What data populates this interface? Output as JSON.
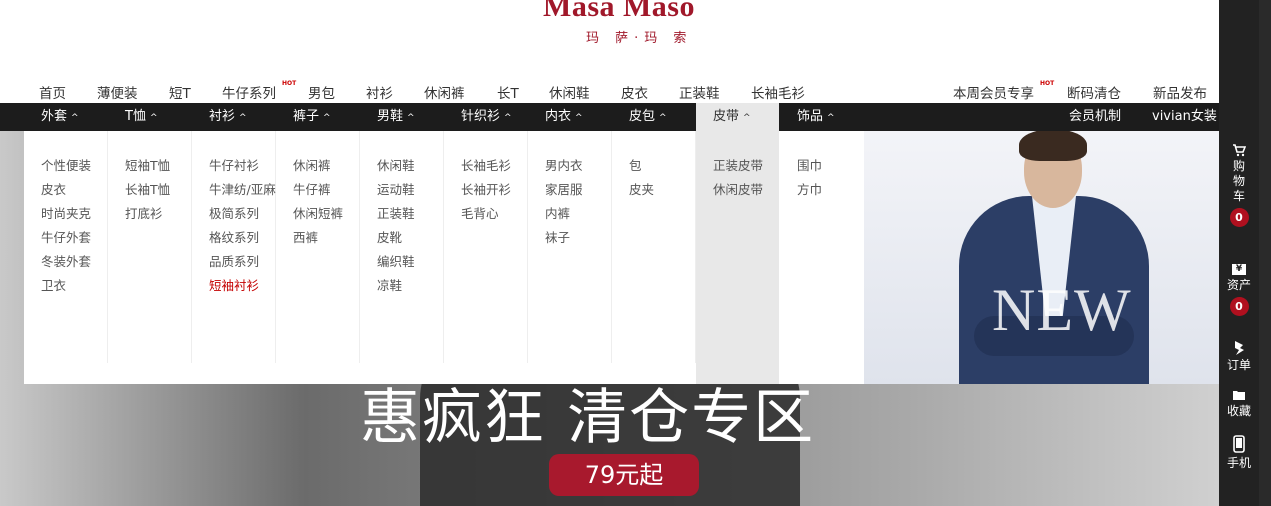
{
  "logo": {
    "main": "Masa Maso",
    "sub": "玛 萨·玛 索"
  },
  "topnav": {
    "left": [
      "首页",
      "薄便装",
      "短T",
      "牛仔系列",
      "男包",
      "衬衫",
      "休闲裤",
      "长T",
      "休闲鞋",
      "皮衣",
      "正装鞋",
      "长袖毛衫"
    ],
    "right": [
      "本周会员专享",
      "断码清仓",
      "新品发布"
    ],
    "hot_label": "HOT"
  },
  "catbar": {
    "categories": [
      "外套",
      "T恤",
      "衬衫",
      "裤子",
      "男鞋",
      "针织衫",
      "内衣",
      "皮包",
      "皮带",
      "饰品"
    ],
    "caret": "^",
    "right": [
      "会员机制",
      "vivian女装"
    ]
  },
  "dropdown": {
    "columns": [
      [
        "个性便装",
        "皮衣",
        "时尚夹克",
        "牛仔外套",
        "冬装外套",
        "卫衣"
      ],
      [
        "短袖T恤",
        "长袖T恤",
        "打底衫"
      ],
      [
        "牛仔衬衫",
        "牛津纺/亚麻",
        "极简系列",
        "格纹系列",
        "品质系列",
        "短袖衬衫"
      ],
      [
        "休闲裤",
        "牛仔裤",
        "休闲短裤",
        "西裤"
      ],
      [
        "休闲鞋",
        "运动鞋",
        "正装鞋",
        "皮靴",
        "编织鞋",
        "凉鞋"
      ],
      [
        "长袖毛衫",
        "长袖开衫",
        "毛背心"
      ],
      [
        "男内衣",
        "家居服",
        "内裤",
        "袜子"
      ],
      [
        "包",
        "皮夹"
      ],
      [
        "正装皮带",
        "休闲皮带"
      ],
      [
        "围巾",
        "方巾"
      ]
    ],
    "highlight": "短袖衬衫"
  },
  "promo": {
    "text": "NEW"
  },
  "hero": {
    "headline": "惠疯狂 清仓专区",
    "button": "79元起"
  },
  "sidebar": {
    "cart": {
      "icon": "cart-icon",
      "label": "购物车",
      "count": "0"
    },
    "assets": {
      "icon": "yen-icon",
      "label": "资产",
      "count": "0"
    },
    "orders": {
      "icon": "order-icon",
      "label": "订单"
    },
    "favorites": {
      "icon": "folder-icon",
      "label": "收藏"
    },
    "mobile": {
      "icon": "phone-icon",
      "label": "手机"
    }
  },
  "colors": {
    "brand": "#a0182a",
    "catbar": "#1c1c1c",
    "highlight": "#c40000",
    "badge": "#b0101f"
  }
}
